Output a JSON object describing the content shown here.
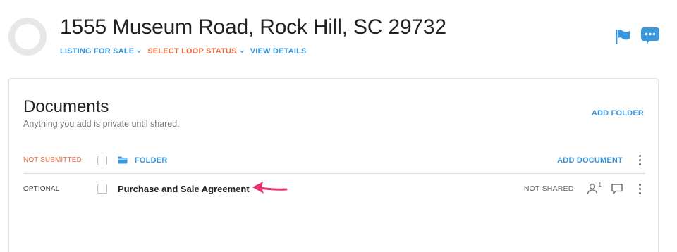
{
  "header": {
    "title": "1555 Museum Road, Rock Hill, SC 29732",
    "nav": {
      "listing_label": "LISTING FOR SALE",
      "status_label": "SELECT LOOP STATUS",
      "details_label": "VIEW DETAILS"
    },
    "icons": [
      "flag-icon",
      "chat-icon"
    ]
  },
  "colors": {
    "accent": "#3a97dc",
    "warning": "#f06a3f",
    "arrow": "#e8356d"
  },
  "documents": {
    "title": "Documents",
    "subtitle": "Anything you add is private until shared.",
    "add_folder_label": "ADD FOLDER",
    "folder_row": {
      "status": "NOT SUBMITTED",
      "folder_label": "FOLDER",
      "add_document_label": "ADD DOCUMENT"
    },
    "items": [
      {
        "status": "OPTIONAL",
        "name": "Purchase and Sale Agreement",
        "share_status": "NOT SHARED",
        "people_count": "1"
      }
    ]
  }
}
